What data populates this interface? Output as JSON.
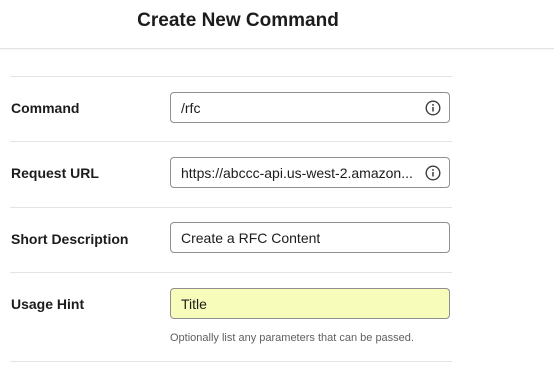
{
  "header": {
    "title": "Create New Command"
  },
  "form": {
    "command": {
      "label": "Command",
      "value": "/rfc",
      "icon": "info-icon"
    },
    "request_url": {
      "label": "Request URL",
      "value": "https://abccc-api.us-west-2.amazon...",
      "icon": "info-icon"
    },
    "short_description": {
      "label": "Short Description",
      "value": "Create a RFC Content"
    },
    "usage_hint": {
      "label": "Usage Hint",
      "value": "Title",
      "help": "Optionally list any parameters that can be passed."
    }
  },
  "colors": {
    "highlight": "#f8fcba",
    "border": "#8f8f8f",
    "divider": "#e4e4e4"
  }
}
